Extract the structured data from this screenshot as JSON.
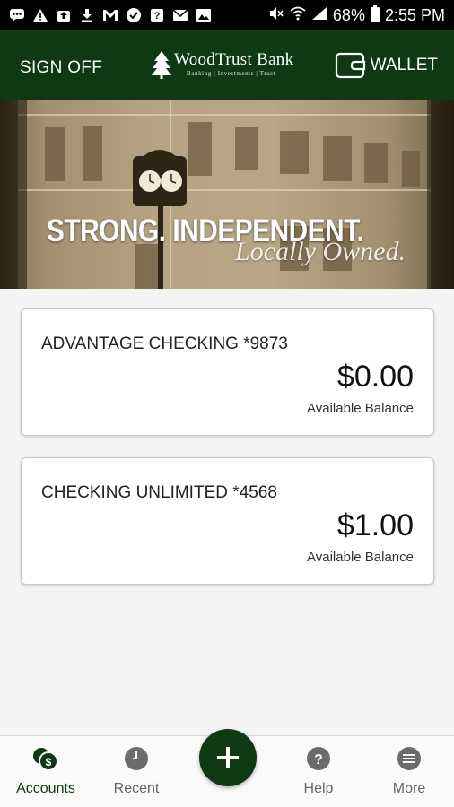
{
  "status_bar": {
    "battery": "68%",
    "time": "2:55 PM",
    "left_icons": [
      "chat-icon",
      "warning-icon",
      "upload-icon",
      "download-icon",
      "gmail-icon",
      "check-icon",
      "unknown-app-icon",
      "mail-icon",
      "image-icon"
    ],
    "right_icons": [
      "mute-icon",
      "wifi-icon",
      "signal-icon",
      "battery-icon"
    ]
  },
  "header": {
    "sign_off": "SIGN OFF",
    "brand_name": "WoodTrust Bank",
    "brand_sub": "Banking | Investments | Trust",
    "wallet": "WALLET",
    "color": "#0d3a12"
  },
  "banner": {
    "headline": "STRONG. INDEPENDENT.",
    "tagline": "Locally Owned."
  },
  "accounts": [
    {
      "name": "ADVANTAGE CHECKING *9873",
      "balance": "$0.00",
      "caption": "Available Balance"
    },
    {
      "name": "CHECKING UNLIMITED *4568",
      "balance": "$1.00",
      "caption": "Available Balance"
    }
  ],
  "nav": {
    "items": [
      {
        "label": "Accounts",
        "icon": "accounts-icon",
        "active": true
      },
      {
        "label": "Recent",
        "icon": "clock-icon",
        "active": false
      },
      {
        "label": "Help",
        "icon": "help-icon",
        "active": false
      },
      {
        "label": "More",
        "icon": "more-icon",
        "active": false
      }
    ],
    "fab_icon": "plus-icon"
  }
}
